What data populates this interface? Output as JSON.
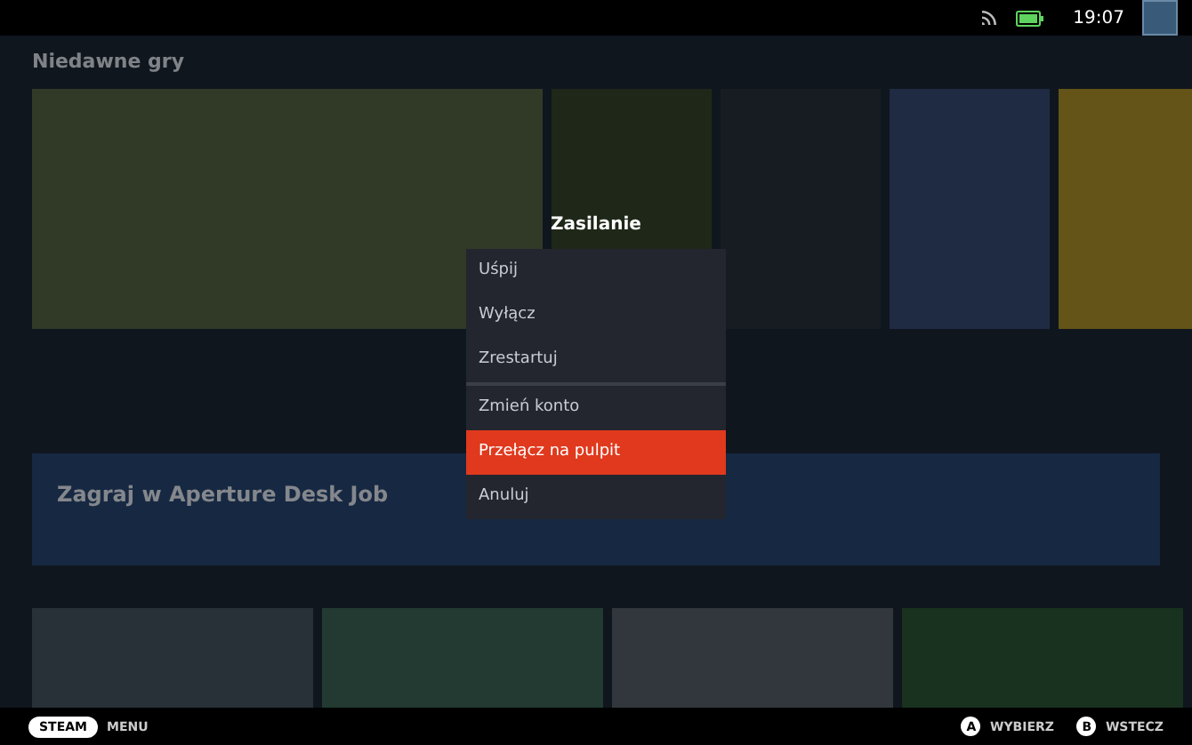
{
  "status_bar": {
    "time": "19:07"
  },
  "home": {
    "recent_heading": "Niedawne gry",
    "banner_title": "Zagraj w Aperture Desk Job"
  },
  "dialog": {
    "title": "Zasilanie",
    "items": [
      {
        "label": "Uśpij",
        "selected": false,
        "separator_after": false
      },
      {
        "label": "Wyłącz",
        "selected": false,
        "separator_after": false
      },
      {
        "label": "Zrestartuj",
        "selected": false,
        "separator_after": true
      },
      {
        "label": "Zmień konto",
        "selected": false,
        "separator_after": false
      },
      {
        "label": "Przełącz na pulpit",
        "selected": true,
        "separator_after": false
      },
      {
        "label": "Anuluj",
        "selected": false,
        "separator_after": false
      }
    ]
  },
  "footer": {
    "badge": "STEAM",
    "label": "MENU",
    "actions": [
      {
        "button": "A",
        "label": "WYBIERZ"
      },
      {
        "button": "B",
        "label": "WSTECZ"
      }
    ]
  }
}
